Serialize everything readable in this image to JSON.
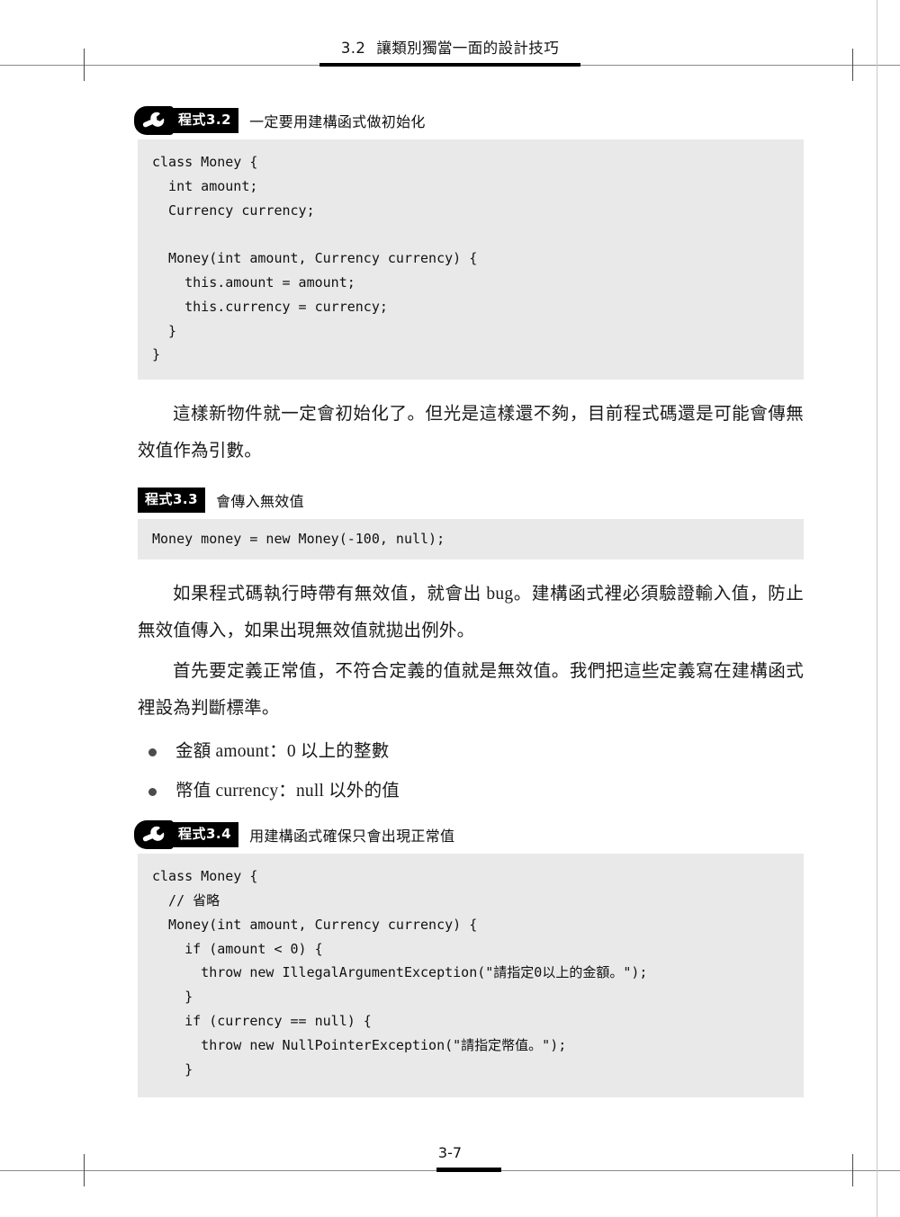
{
  "page": {
    "running_head": {
      "section_number": "3.2",
      "section_title": "讓類別獨當一面的設計技巧"
    },
    "folio": "3-7"
  },
  "listings": [
    {
      "icon": "wrench-icon",
      "tag": "程式3.2",
      "title": "一定要用建構函式做初始化",
      "code": "class Money {\n  int amount;\n  Currency currency;\n\n  Money(int amount, Currency currency) {\n    this.amount = amount;\n    this.currency = currency;\n  }\n}"
    },
    {
      "icon": null,
      "tag": "程式3.3",
      "title": "會傳入無效值",
      "code": "Money money = new Money(-100, null);"
    },
    {
      "icon": "wrench-icon",
      "tag": "程式3.4",
      "title": "用建構函式確保只會出現正常值",
      "code": "class Money {\n  // 省略\n  Money(int amount, Currency currency) {\n    if (amount < 0) {\n      throw new IllegalArgumentException(\"請指定0以上的金額。\");\n    }\n    if (currency == null) {\n      throw new NullPointerException(\"請指定幣值。\");\n    }"
    }
  ],
  "paragraphs": {
    "p1": "這樣新物件就一定會初始化了。但光是這樣還不夠，目前程式碼還是可能會傳無效值作為引數。",
    "p2": "如果程式碼執行時帶有無效值，就會出 bug。建構函式裡必須驗證輸入值，防止無效值傳入，如果出現無效值就拋出例外。",
    "p3": "首先要定義正常值，不符合定義的值就是無效值。我們把這些定義寫在建構函式裡設為判斷標準。"
  },
  "bullets": [
    {
      "text": "金額 amount：0 以上的整數"
    },
    {
      "text": "幣值 currency：null 以外的值"
    }
  ],
  "colors": {
    "code_background": "#e9e9e9",
    "tag_background": "#000000",
    "tag_text": "#ffffff",
    "bullet": "#4c4c4c"
  }
}
